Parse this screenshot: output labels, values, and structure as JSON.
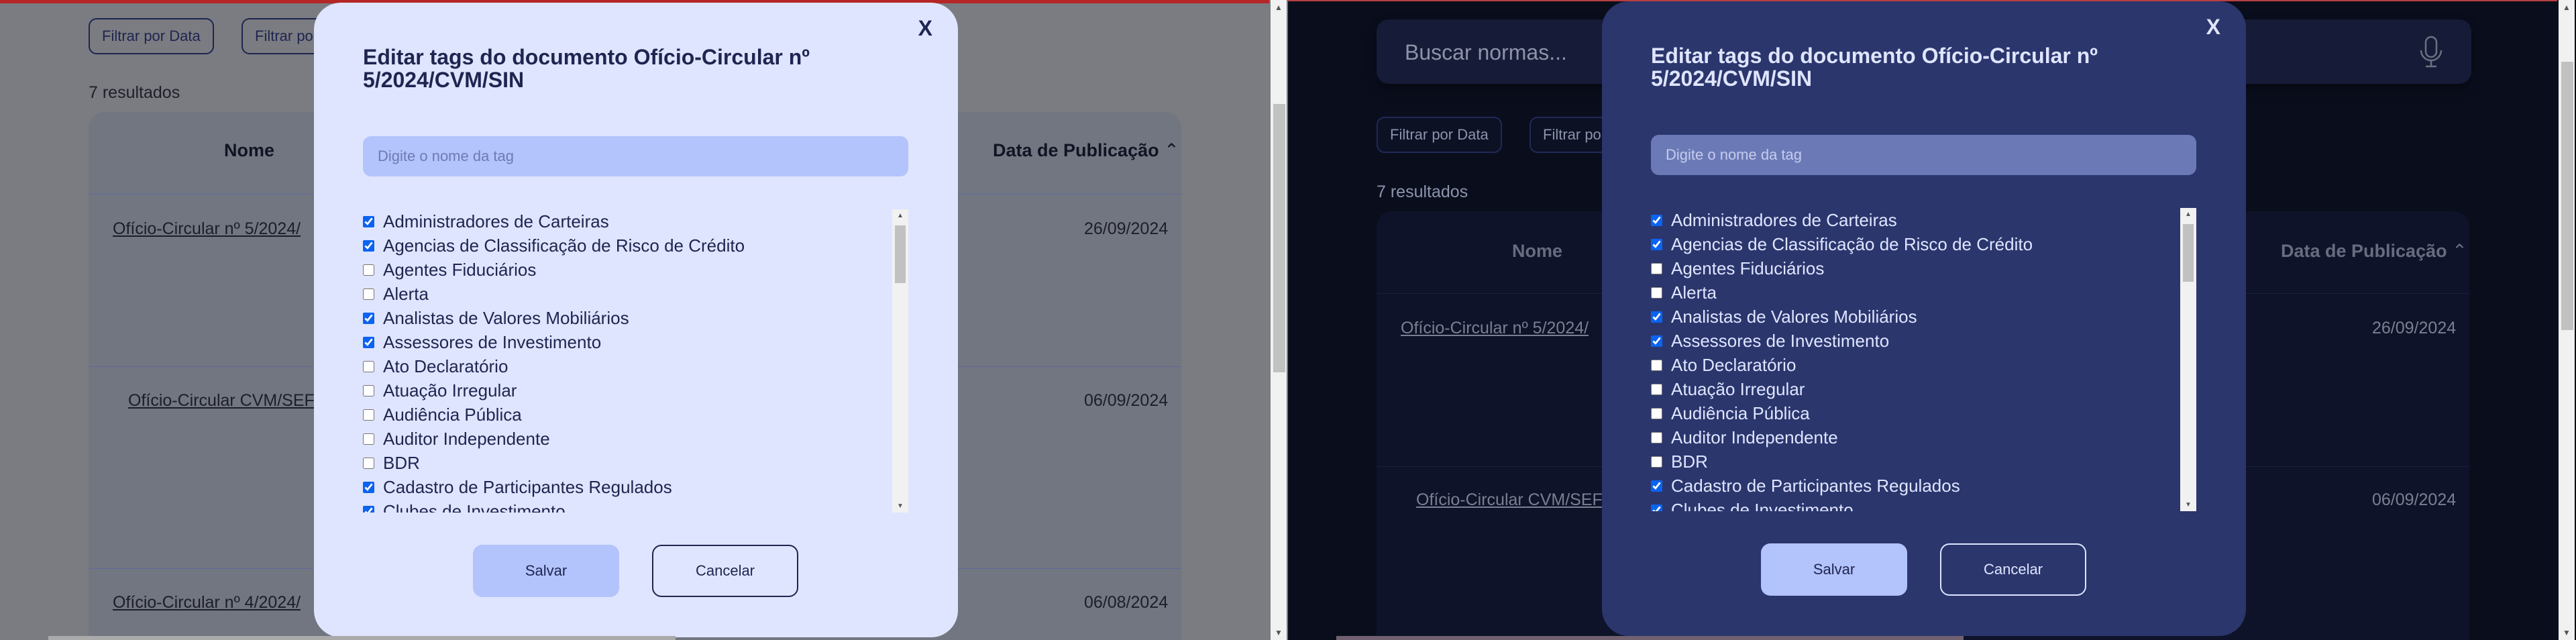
{
  "colors": {
    "accent": "#1e2550",
    "modal_light": "#dfe5fe",
    "modal_dark": "#2b366d",
    "input_light": "#b3c3fb",
    "checkbox": "#0b63f2"
  },
  "page": {
    "search_placeholder": "Buscar normas...",
    "mic_icon": "microphone-icon",
    "filters": [
      "Filtrar por Data",
      "Filtrar por"
    ],
    "results_count": "7 resultados",
    "columns": {
      "name": "Nome",
      "date": "Data de Publicação",
      "sort_icon": "chevron-up-icon"
    },
    "rows": [
      {
        "name": "Ofício-Circular nº 5/2024/",
        "date": "26/09/2024"
      },
      {
        "name": "Ofício-Circular CVM/SEF",
        "date": "06/09/2024"
      },
      {
        "name": "Ofício-Circular nº 4/2024/",
        "date": "06/08/2024"
      }
    ]
  },
  "modal": {
    "close_label": "X",
    "title": "Editar tags do documento Ofício-Circular nº 5/2024/CVM/SIN",
    "input_placeholder": "Digite o nome da tag",
    "tags": [
      {
        "label": "Administradores de Carteiras",
        "checked": true
      },
      {
        "label": "Agencias de Classificação de Risco de Crédito",
        "checked": true
      },
      {
        "label": "Agentes Fiduciários",
        "checked": false
      },
      {
        "label": "Alerta",
        "checked": false
      },
      {
        "label": "Analistas de Valores Mobiliários",
        "checked": true
      },
      {
        "label": "Assessores de Investimento",
        "checked": true
      },
      {
        "label": "Ato Declaratório",
        "checked": false
      },
      {
        "label": "Atuação Irregular",
        "checked": false
      },
      {
        "label": "Audiência Pública",
        "checked": false
      },
      {
        "label": "Auditor Independente",
        "checked": false
      },
      {
        "label": "BDR",
        "checked": false
      },
      {
        "label": "Cadastro de Participantes Regulados",
        "checked": true
      },
      {
        "label": "Clubes de Investimento",
        "checked": true
      }
    ],
    "save_label": "Salvar",
    "cancel_label": "Cancelar"
  }
}
